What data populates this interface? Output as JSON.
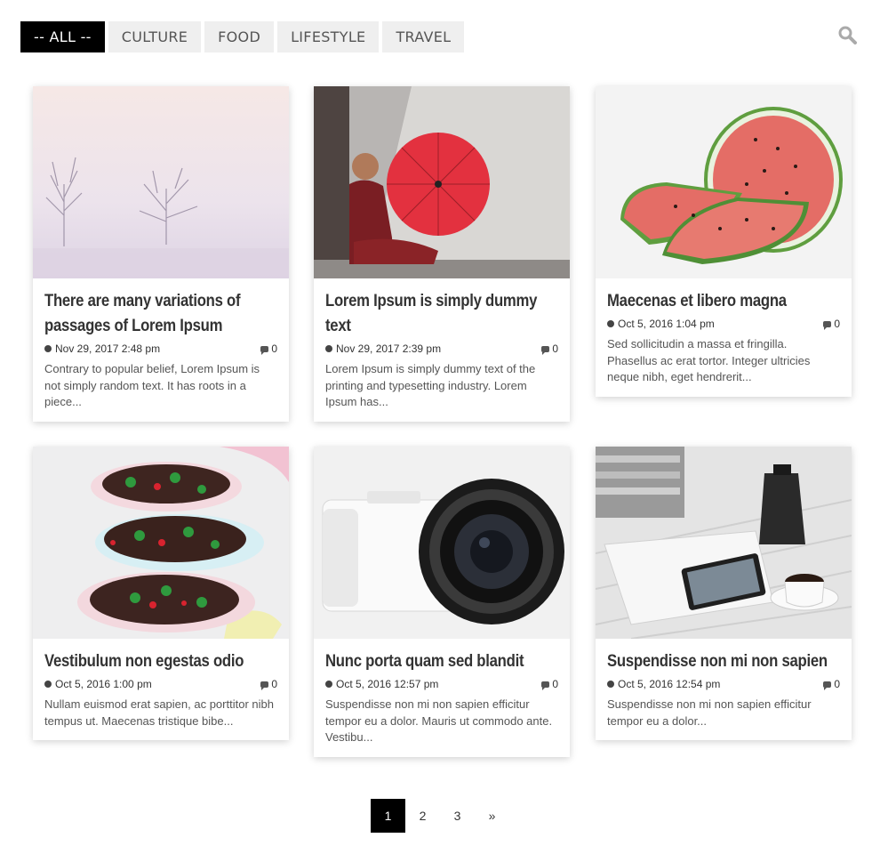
{
  "filters": {
    "all": "-- ALL --",
    "culture": "CULTURE",
    "food": "FOOD",
    "lifestyle": "LIFESTYLE",
    "travel": "TRAVEL"
  },
  "posts": [
    {
      "title": "There are many variations of passages of Lorem Ipsum",
      "date": "Nov 29, 2017 2:48 pm",
      "comments": "0",
      "excerpt": "Contrary to popular belief, Lorem Ipsum is not simply random text. It has roots in a piece..."
    },
    {
      "title": "Lorem Ipsum is simply dummy text",
      "date": "Nov 29, 2017 2:39 pm",
      "comments": "0",
      "excerpt": "Lorem Ipsum is simply dummy text of the printing and typesetting industry. Lorem Ipsum has..."
    },
    {
      "title": "Maecenas et libero magna",
      "date": "Oct 5, 2016 1:04 pm",
      "comments": "0",
      "excerpt": "Sed sollicitudin a massa et fringilla. Phasellus ac erat tortor. Integer ultricies neque nibh, eget hendrerit..."
    },
    {
      "title": "Vestibulum non egestas odio",
      "date": "Oct 5, 2016 1:00 pm",
      "comments": "0",
      "excerpt": "Nullam euismod erat sapien, ac porttitor nibh tempus ut. Maecenas tristique bibe..."
    },
    {
      "title": "Nunc porta quam sed blandit",
      "date": "Oct 5, 2016 12:57 pm",
      "comments": "0",
      "excerpt": "Suspendisse non mi non sapien efficitur tempor eu a dolor. Mauris ut commodo ante. Vestibu..."
    },
    {
      "title": "Suspendisse non mi non sapien",
      "date": "Oct 5, 2016 12:54 pm",
      "comments": "0",
      "excerpt": "Suspendisse non mi non sapien efficitur tempor eu a dolor..."
    }
  ],
  "pagination": {
    "current": "1",
    "p2": "2",
    "p3": "3",
    "next": "»"
  },
  "icons": {
    "search": "search-icon",
    "date": "clock-icon",
    "comments": "comment-icon"
  },
  "colors": {
    "active_filter_bg": "#000000",
    "filter_bg": "#efefef",
    "text": "#333333"
  }
}
